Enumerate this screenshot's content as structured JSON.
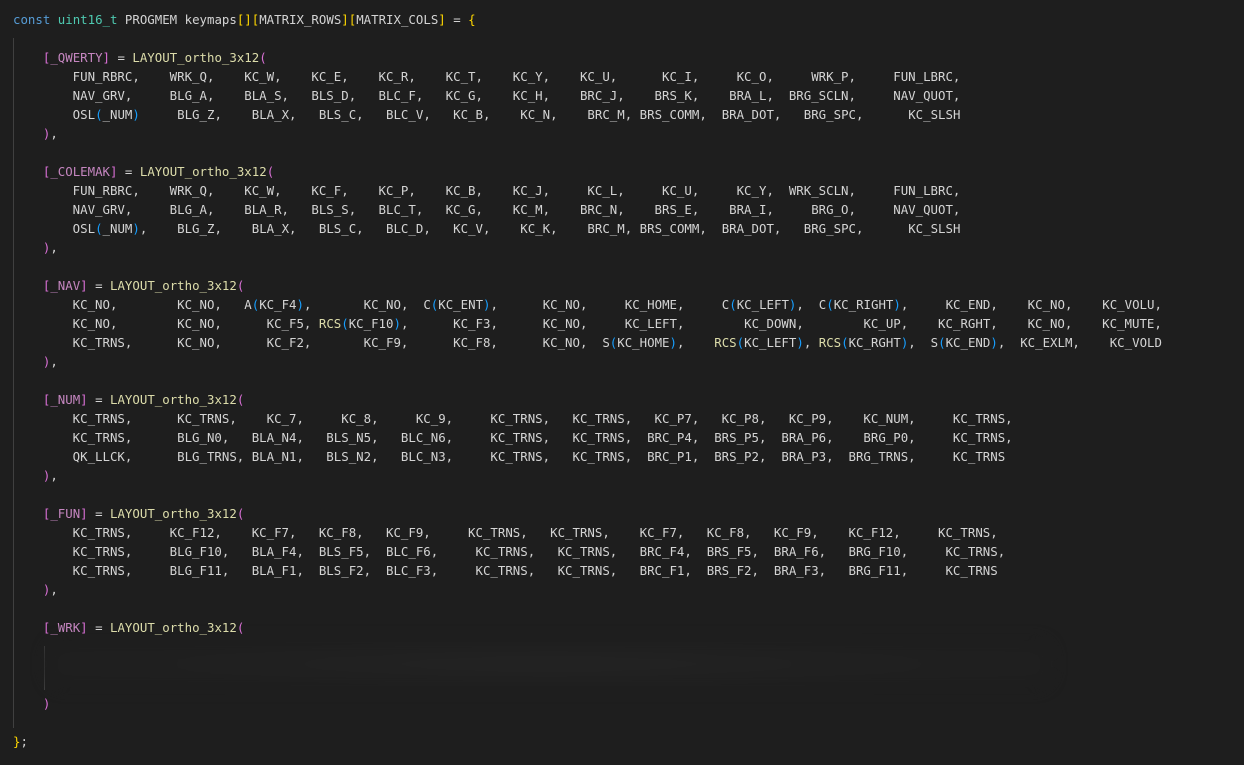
{
  "colors": {
    "background": "#1e1e1e",
    "text": "#d4d4d4",
    "keyword": "#569cd6",
    "type": "#4ec9b0",
    "function": "#dcdcaa",
    "macro": "#c586c0",
    "bracket_level1": "#ffd700",
    "bracket_level2": "#da70d6",
    "bracket_level3": "#179fff"
  },
  "lines": [
    {
      "segs": [
        [
          "kw",
          "const"
        ],
        [
          "pl",
          " "
        ],
        [
          "ty",
          "uint16_t"
        ],
        [
          "pl",
          " PROGMEM keymaps"
        ],
        [
          "br1",
          "[]"
        ],
        [
          "br1",
          "["
        ],
        [
          "pl",
          "MATRIX_ROWS"
        ],
        [
          "br1",
          "]"
        ],
        [
          "br1",
          "["
        ],
        [
          "pl",
          "MATRIX_COLS"
        ],
        [
          "br1",
          "]"
        ],
        [
          "pl",
          " = "
        ],
        [
          "br1",
          "{"
        ]
      ]
    },
    {
      "segs": []
    },
    {
      "segs": [
        [
          "pl",
          "    "
        ],
        [
          "br2",
          "["
        ],
        [
          "df",
          "_QWERTY"
        ],
        [
          "br2",
          "]"
        ],
        [
          "pl",
          " = "
        ],
        [
          "fn",
          "LAYOUT_ortho_3x12"
        ],
        [
          "br2",
          "("
        ]
      ]
    },
    {
      "segs": [
        [
          "pl",
          "        FUN_RBRC,    WRK_Q,    KC_W,    KC_E,    KC_R,    KC_T,    KC_Y,    KC_U,      KC_I,     KC_O,     WRK_P,     FUN_LBRC,"
        ]
      ]
    },
    {
      "segs": [
        [
          "pl",
          "        NAV_GRV,     BLG_A,    BLA_S,   BLS_D,   BLC_F,   KC_G,    KC_H,    BRC_J,    BRS_K,    BRA_L,  BRG_SCLN,     NAV_QUOT,"
        ]
      ]
    },
    {
      "segs": [
        [
          "pl",
          "        OSL"
        ],
        [
          "br3",
          "("
        ],
        [
          "pl",
          "_NUM"
        ],
        [
          "br3",
          ")"
        ],
        [
          "pl",
          "     BLG_Z,    BLA_X,   BLS_C,   BLC_V,   KC_B,    KC_N,    BRC_M, BRS_COMM,  BRA_DOT,   BRG_SPC,      KC_SLSH"
        ]
      ]
    },
    {
      "segs": [
        [
          "pl",
          "    "
        ],
        [
          "br2",
          ")"
        ],
        [
          "pl",
          ","
        ]
      ]
    },
    {
      "segs": []
    },
    {
      "segs": [
        [
          "pl",
          "    "
        ],
        [
          "br2",
          "["
        ],
        [
          "df",
          "_COLEMAK"
        ],
        [
          "br2",
          "]"
        ],
        [
          "pl",
          " = "
        ],
        [
          "fn",
          "LAYOUT_ortho_3x12"
        ],
        [
          "br2",
          "("
        ]
      ]
    },
    {
      "segs": [
        [
          "pl",
          "        FUN_RBRC,    WRK_Q,    KC_W,    KC_F,    KC_P,    KC_B,    KC_J,     KC_L,     KC_U,     KC_Y,  WRK_SCLN,     FUN_LBRC,"
        ]
      ]
    },
    {
      "segs": [
        [
          "pl",
          "        NAV_GRV,     BLG_A,    BLA_R,   BLS_S,   BLC_T,   KC_G,    KC_M,    BRC_N,    BRS_E,    BRA_I,     BRG_O,     NAV_QUOT,"
        ]
      ]
    },
    {
      "segs": [
        [
          "pl",
          "        OSL"
        ],
        [
          "br3",
          "("
        ],
        [
          "pl",
          "_NUM"
        ],
        [
          "br3",
          ")"
        ],
        [
          "pl",
          ",    BLG_Z,    BLA_X,   BLS_C,   BLC_D,   KC_V,    KC_K,    BRC_M, BRS_COMM,  BRA_DOT,   BRG_SPC,      KC_SLSH"
        ]
      ]
    },
    {
      "segs": [
        [
          "pl",
          "    "
        ],
        [
          "br2",
          ")"
        ],
        [
          "pl",
          ","
        ]
      ]
    },
    {
      "segs": []
    },
    {
      "segs": [
        [
          "pl",
          "    "
        ],
        [
          "br2",
          "["
        ],
        [
          "df",
          "_NAV"
        ],
        [
          "br2",
          "]"
        ],
        [
          "pl",
          " = "
        ],
        [
          "fn",
          "LAYOUT_ortho_3x12"
        ],
        [
          "br2",
          "("
        ]
      ]
    },
    {
      "segs": [
        [
          "pl",
          "        KC_NO,        KC_NO,   A"
        ],
        [
          "br3",
          "("
        ],
        [
          "pl",
          "KC_F4"
        ],
        [
          "br3",
          ")"
        ],
        [
          "pl",
          ",       KC_NO,  C"
        ],
        [
          "br3",
          "("
        ],
        [
          "pl",
          "KC_ENT"
        ],
        [
          "br3",
          ")"
        ],
        [
          "pl",
          ",      KC_NO,     KC_HOME,     C"
        ],
        [
          "br3",
          "("
        ],
        [
          "pl",
          "KC_LEFT"
        ],
        [
          "br3",
          ")"
        ],
        [
          "pl",
          ",  C"
        ],
        [
          "br3",
          "("
        ],
        [
          "pl",
          "KC_RIGHT"
        ],
        [
          "br3",
          ")"
        ],
        [
          "pl",
          ",     KC_END,    KC_NO,    KC_VOLU,"
        ]
      ]
    },
    {
      "segs": [
        [
          "pl",
          "        KC_NO,        KC_NO,      KC_F5, "
        ],
        [
          "fn",
          "RCS"
        ],
        [
          "br3",
          "("
        ],
        [
          "pl",
          "KC_F10"
        ],
        [
          "br3",
          ")"
        ],
        [
          "pl",
          ",      KC_F3,      KC_NO,     KC_LEFT,        KC_DOWN,        KC_UP,    KC_RGHT,    KC_NO,    KC_MUTE,"
        ]
      ]
    },
    {
      "segs": [
        [
          "pl",
          "        KC_TRNS,      KC_NO,      KC_F2,       KC_F9,      KC_F8,      KC_NO,  S"
        ],
        [
          "br3",
          "("
        ],
        [
          "pl",
          "KC_HOME"
        ],
        [
          "br3",
          ")"
        ],
        [
          "pl",
          ",    "
        ],
        [
          "fn",
          "RCS"
        ],
        [
          "br3",
          "("
        ],
        [
          "pl",
          "KC_LEFT"
        ],
        [
          "br3",
          ")"
        ],
        [
          "pl",
          ", "
        ],
        [
          "fn",
          "RCS"
        ],
        [
          "br3",
          "("
        ],
        [
          "pl",
          "KC_RGHT"
        ],
        [
          "br3",
          ")"
        ],
        [
          "pl",
          ",  S"
        ],
        [
          "br3",
          "("
        ],
        [
          "pl",
          "KC_END"
        ],
        [
          "br3",
          ")"
        ],
        [
          "pl",
          ",  KC_EXLM,    KC_VOLD"
        ]
      ]
    },
    {
      "segs": [
        [
          "pl",
          "    "
        ],
        [
          "br2",
          ")"
        ],
        [
          "pl",
          ","
        ]
      ]
    },
    {
      "segs": []
    },
    {
      "segs": [
        [
          "pl",
          "    "
        ],
        [
          "br2",
          "["
        ],
        [
          "df",
          "_NUM"
        ],
        [
          "br2",
          "]"
        ],
        [
          "pl",
          " = "
        ],
        [
          "fn",
          "LAYOUT_ortho_3x12"
        ],
        [
          "br2",
          "("
        ]
      ]
    },
    {
      "segs": [
        [
          "pl",
          "        KC_TRNS,      KC_TRNS,    KC_7,     KC_8,     KC_9,     KC_TRNS,   KC_TRNS,   KC_P7,   KC_P8,   KC_P9,    KC_NUM,     KC_TRNS,"
        ]
      ]
    },
    {
      "segs": [
        [
          "pl",
          "        KC_TRNS,      BLG_N0,   BLA_N4,   BLS_N5,   BLC_N6,     KC_TRNS,   KC_TRNS,  BRC_P4,  BRS_P5,  BRA_P6,    BRG_P0,     KC_TRNS,"
        ]
      ]
    },
    {
      "segs": [
        [
          "pl",
          "        QK_LLCK,      BLG_TRNS, BLA_N1,   BLS_N2,   BLC_N3,     KC_TRNS,   KC_TRNS,  BRC_P1,  BRS_P2,  BRA_P3,  BRG_TRNS,     KC_TRNS"
        ]
      ]
    },
    {
      "segs": [
        [
          "pl",
          "    "
        ],
        [
          "br2",
          ")"
        ],
        [
          "pl",
          ","
        ]
      ]
    },
    {
      "segs": []
    },
    {
      "segs": [
        [
          "pl",
          "    "
        ],
        [
          "br2",
          "["
        ],
        [
          "df",
          "_FUN"
        ],
        [
          "br2",
          "]"
        ],
        [
          "pl",
          " = "
        ],
        [
          "fn",
          "LAYOUT_ortho_3x12"
        ],
        [
          "br2",
          "("
        ]
      ]
    },
    {
      "segs": [
        [
          "pl",
          "        KC_TRNS,     KC_F12,    KC_F7,   KC_F8,   KC_F9,     KC_TRNS,   KC_TRNS,    KC_F7,   KC_F8,   KC_F9,    KC_F12,     KC_TRNS,"
        ]
      ]
    },
    {
      "segs": [
        [
          "pl",
          "        KC_TRNS,     BLG_F10,   BLA_F4,  BLS_F5,  BLC_F6,     KC_TRNS,   KC_TRNS,   BRC_F4,  BRS_F5,  BRA_F6,   BRG_F10,     KC_TRNS,"
        ]
      ]
    },
    {
      "segs": [
        [
          "pl",
          "        KC_TRNS,     BLG_F11,   BLA_F1,  BLS_F2,  BLC_F3,     KC_TRNS,   KC_TRNS,   BRC_F1,  BRS_F2,  BRA_F3,   BRG_F11,     KC_TRNS"
        ]
      ]
    },
    {
      "segs": [
        [
          "pl",
          "    "
        ],
        [
          "br2",
          ")"
        ],
        [
          "pl",
          ","
        ]
      ]
    },
    {
      "segs": []
    },
    {
      "segs": [
        [
          "pl",
          "    "
        ],
        [
          "br2",
          "["
        ],
        [
          "df",
          "_WRK"
        ],
        [
          "br2",
          "]"
        ],
        [
          "pl",
          " = "
        ],
        [
          "fn",
          "LAYOUT_ortho_3x12"
        ],
        [
          "br2",
          "("
        ]
      ]
    },
    {
      "segs": []
    },
    {
      "segs": []
    },
    {
      "segs": []
    },
    {
      "segs": [
        [
          "pl",
          "    "
        ],
        [
          "br2",
          ")"
        ]
      ]
    },
    {
      "segs": []
    },
    {
      "segs": [
        [
          "br1",
          "}"
        ],
        [
          "pl",
          ";"
        ]
      ]
    }
  ]
}
